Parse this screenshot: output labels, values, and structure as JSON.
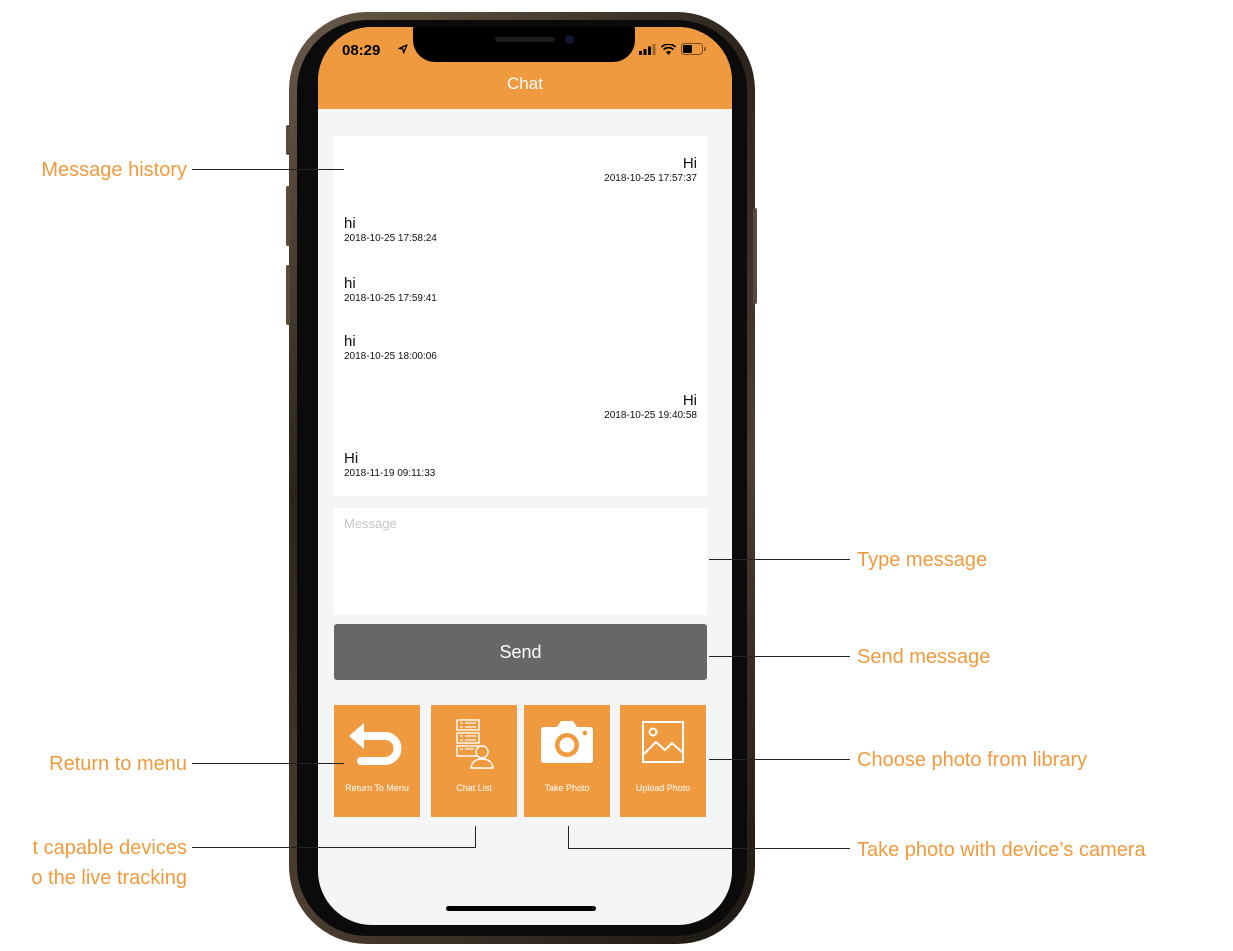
{
  "status_bar": {
    "time": "08:29"
  },
  "nav": {
    "title": "Chat"
  },
  "history": {
    "messages": [
      {
        "text": "Hi",
        "time": "2018-10-25 17:57:37",
        "side": "right"
      },
      {
        "text": "hi",
        "time": "2018-10-25 17:58:24",
        "side": "left"
      },
      {
        "text": "hi",
        "time": "2018-10-25 17:59:41",
        "side": "left"
      },
      {
        "text": "hi",
        "time": "2018-10-25 18:00:06",
        "side": "left"
      },
      {
        "text": "Hi",
        "time": "2018-10-25 19:40:58",
        "side": "right"
      },
      {
        "text": "Hi",
        "time": "2018-11-19 09:11:33",
        "side": "left"
      }
    ]
  },
  "input": {
    "placeholder": "Message"
  },
  "send": {
    "label": "Send"
  },
  "actions": [
    {
      "label": "Return To Menu",
      "icon": "return-arrow-icon"
    },
    {
      "label": "Chat List",
      "icon": "chat-list-icon"
    },
    {
      "label": "Take Photo",
      "icon": "camera-icon"
    },
    {
      "label": "Upload Photo",
      "icon": "image-icon"
    }
  ],
  "callouts": {
    "message_history": "Message history",
    "type_message": "Type message",
    "send_message": "Send message",
    "return_to_menu": "Return to menu",
    "choose_photo": "Choose photo from library",
    "chat_list_line1": "t capable devices",
    "chat_list_line2": "o the live tracking",
    "take_photo": "Take photo with device’s camera"
  },
  "colors": {
    "accent": "#ef9a3e",
    "send_button": "#666866",
    "background": "#f4f5f6"
  }
}
